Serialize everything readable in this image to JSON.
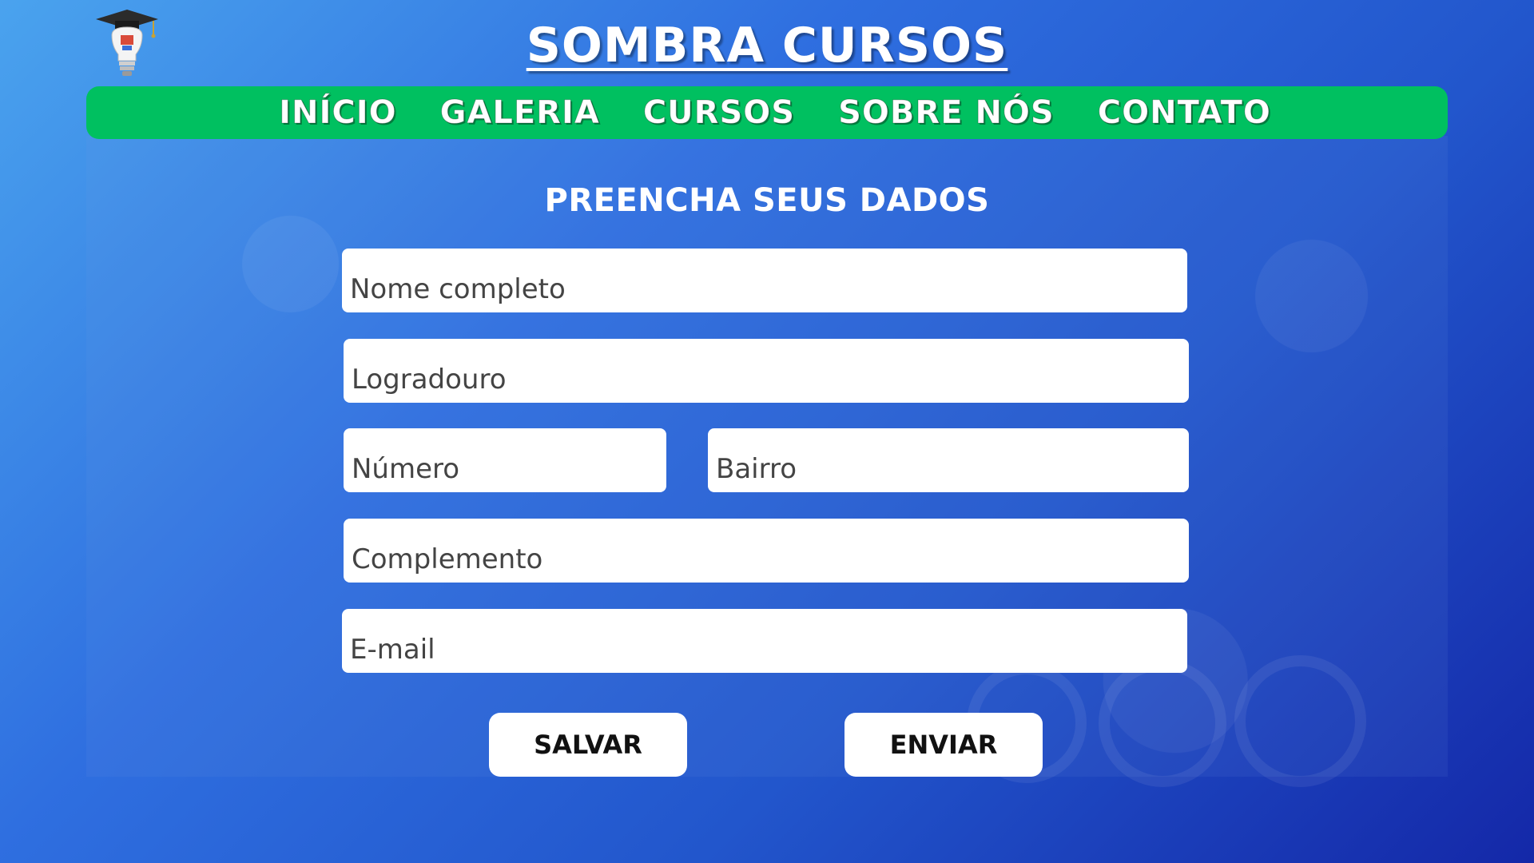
{
  "header": {
    "title": "SOMBRA CURSOS",
    "logo_icon": "graduation-lightbulb-icon"
  },
  "nav": {
    "items": [
      "INÍCIO",
      "GALERIA",
      "CURSOS",
      "SOBRE NÓS",
      "CONTATO"
    ]
  },
  "form": {
    "heading": "PREENCHA SEUS DADOS",
    "fields": {
      "nome": "Nome completo",
      "logradouro": "Logradouro",
      "numero": "Número",
      "bairro": "Bairro",
      "complemento": "Complemento",
      "email": "E-mail"
    },
    "buttons": {
      "salvar": "SALVAR",
      "enviar": "ENVIAR"
    }
  },
  "colors": {
    "nav_bg": "#00c060",
    "field_bg": "#ffffff",
    "text_light": "#ffffff"
  }
}
